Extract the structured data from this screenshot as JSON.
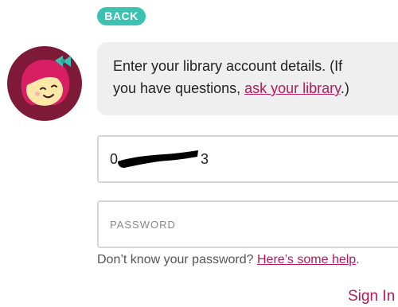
{
  "back_button": {
    "label": "BACK"
  },
  "message": {
    "line1": "Enter your library account details. (If",
    "line2_prefix": "you have questions, ",
    "line2_link": "ask your library",
    "line2_suffix": ".)"
  },
  "card_field": {
    "value_start": "0",
    "value_end": "3"
  },
  "password_field": {
    "placeholder": "PASSWORD"
  },
  "help": {
    "prefix": "Don’t know your password? ",
    "link": "Here’s some help",
    "suffix": "."
  },
  "sign_in": {
    "label": "Sign In"
  },
  "colors": {
    "accent": "#3cc2b3",
    "link": "#b5195b",
    "avatar_bg": "#8a1a3b",
    "bubble_bg": "#efefef"
  },
  "icons": {
    "avatar": "libby-avatar-icon"
  }
}
